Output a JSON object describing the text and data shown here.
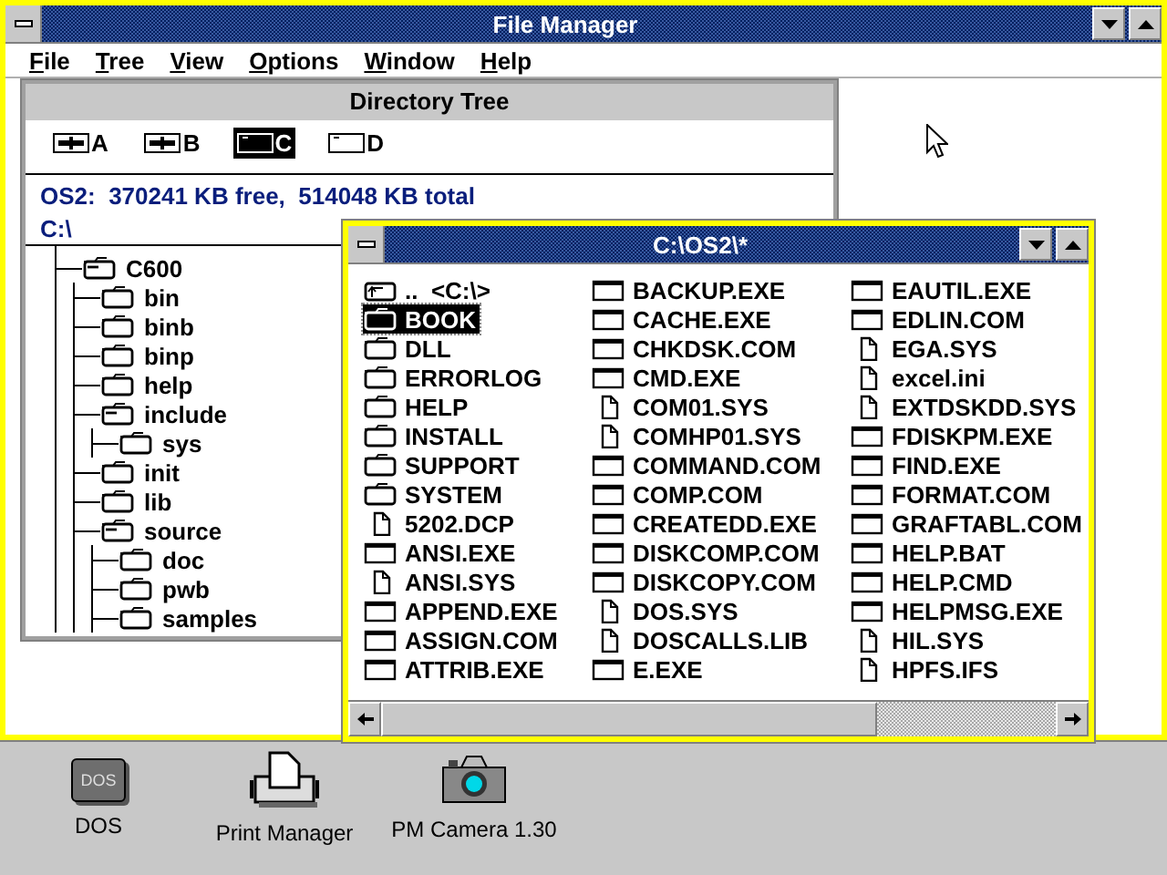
{
  "window": {
    "title": "File Manager"
  },
  "menu": [
    {
      "label": "File"
    },
    {
      "label": "Tree"
    },
    {
      "label": "View"
    },
    {
      "label": "Options"
    },
    {
      "label": "Window"
    },
    {
      "label": "Help"
    }
  ],
  "directory_tree": {
    "title": "Directory Tree",
    "drives": [
      {
        "label": "A",
        "kind": "floppy",
        "selected": false
      },
      {
        "label": "B",
        "kind": "floppy",
        "selected": false
      },
      {
        "label": "C",
        "kind": "hard",
        "selected": true
      },
      {
        "label": "D",
        "kind": "hard",
        "selected": false
      }
    ],
    "info": "OS2:  370241 KB free,  514048 KB total",
    "path": "C:\\",
    "tree": [
      {
        "label": "C600",
        "expanded": true,
        "children": [
          {
            "label": "bin",
            "expanded": false
          },
          {
            "label": "binb",
            "expanded": false
          },
          {
            "label": "binp",
            "expanded": false
          },
          {
            "label": "help",
            "expanded": false
          },
          {
            "label": "include",
            "expanded": true,
            "children": [
              {
                "label": "sys",
                "expanded": false
              }
            ]
          },
          {
            "label": "init",
            "expanded": false
          },
          {
            "label": "lib",
            "expanded": false
          },
          {
            "label": "source",
            "expanded": true,
            "children": [
              {
                "label": "doc",
                "expanded": false
              },
              {
                "label": "pwb",
                "expanded": false
              },
              {
                "label": "samples",
                "expanded": false
              }
            ]
          }
        ]
      }
    ]
  },
  "file_window": {
    "title": "C:\\OS2\\*",
    "items": [
      {
        "label": "..  <C:\\>",
        "kind": "parent",
        "selected": false
      },
      {
        "label": "BOOK",
        "kind": "folder",
        "selected": true
      },
      {
        "label": "DLL",
        "kind": "folder",
        "selected": false
      },
      {
        "label": "ERRORLOG",
        "kind": "folder",
        "selected": false
      },
      {
        "label": "HELP",
        "kind": "folder",
        "selected": false
      },
      {
        "label": "INSTALL",
        "kind": "folder",
        "selected": false
      },
      {
        "label": "SUPPORT",
        "kind": "folder",
        "selected": false
      },
      {
        "label": "SYSTEM",
        "kind": "folder",
        "selected": false
      },
      {
        "label": "5202.DCP",
        "kind": "file",
        "selected": false
      },
      {
        "label": "ANSI.EXE",
        "kind": "program",
        "selected": false
      },
      {
        "label": "ANSI.SYS",
        "kind": "file",
        "selected": false
      },
      {
        "label": "APPEND.EXE",
        "kind": "program",
        "selected": false
      },
      {
        "label": "ASSIGN.COM",
        "kind": "program",
        "selected": false
      },
      {
        "label": "ATTRIB.EXE",
        "kind": "program",
        "selected": false
      },
      {
        "label": "BACKUP.EXE",
        "kind": "program",
        "selected": false
      },
      {
        "label": "CACHE.EXE",
        "kind": "program",
        "selected": false
      },
      {
        "label": "CHKDSK.COM",
        "kind": "program",
        "selected": false
      },
      {
        "label": "CMD.EXE",
        "kind": "program",
        "selected": false
      },
      {
        "label": "COM01.SYS",
        "kind": "file",
        "selected": false
      },
      {
        "label": "COMHP01.SYS",
        "kind": "file",
        "selected": false
      },
      {
        "label": "COMMAND.COM",
        "kind": "program",
        "selected": false
      },
      {
        "label": "COMP.COM",
        "kind": "program",
        "selected": false
      },
      {
        "label": "CREATEDD.EXE",
        "kind": "program",
        "selected": false
      },
      {
        "label": "DISKCOMP.COM",
        "kind": "program",
        "selected": false
      },
      {
        "label": "DISKCOPY.COM",
        "kind": "program",
        "selected": false
      },
      {
        "label": "DOS.SYS",
        "kind": "file",
        "selected": false
      },
      {
        "label": "DOSCALLS.LIB",
        "kind": "file",
        "selected": false
      },
      {
        "label": "E.EXE",
        "kind": "program",
        "selected": false
      },
      {
        "label": "EAUTIL.EXE",
        "kind": "program",
        "selected": false
      },
      {
        "label": "EDLIN.COM",
        "kind": "program",
        "selected": false
      },
      {
        "label": "EGA.SYS",
        "kind": "file",
        "selected": false
      },
      {
        "label": "excel.ini",
        "kind": "file",
        "selected": false
      },
      {
        "label": "EXTDSKDD.SYS",
        "kind": "file",
        "selected": false
      },
      {
        "label": "FDISKPM.EXE",
        "kind": "program",
        "selected": false
      },
      {
        "label": "FIND.EXE",
        "kind": "program",
        "selected": false
      },
      {
        "label": "FORMAT.COM",
        "kind": "program",
        "selected": false
      },
      {
        "label": "GRAFTABL.COM",
        "kind": "program",
        "selected": false
      },
      {
        "label": "HELP.BAT",
        "kind": "program",
        "selected": false
      },
      {
        "label": "HELP.CMD",
        "kind": "program",
        "selected": false
      },
      {
        "label": "HELPMSG.EXE",
        "kind": "program",
        "selected": false
      },
      {
        "label": "HIL.SYS",
        "kind": "file",
        "selected": false
      },
      {
        "label": "HPFS.IFS",
        "kind": "file",
        "selected": false
      }
    ]
  },
  "desktop_icons": [
    {
      "label": "DOS",
      "kind": "dos",
      "icon_text": "DOS"
    },
    {
      "label": "Print Manager",
      "kind": "printer"
    },
    {
      "label": "PM Camera 1.30",
      "kind": "camera"
    }
  ]
}
